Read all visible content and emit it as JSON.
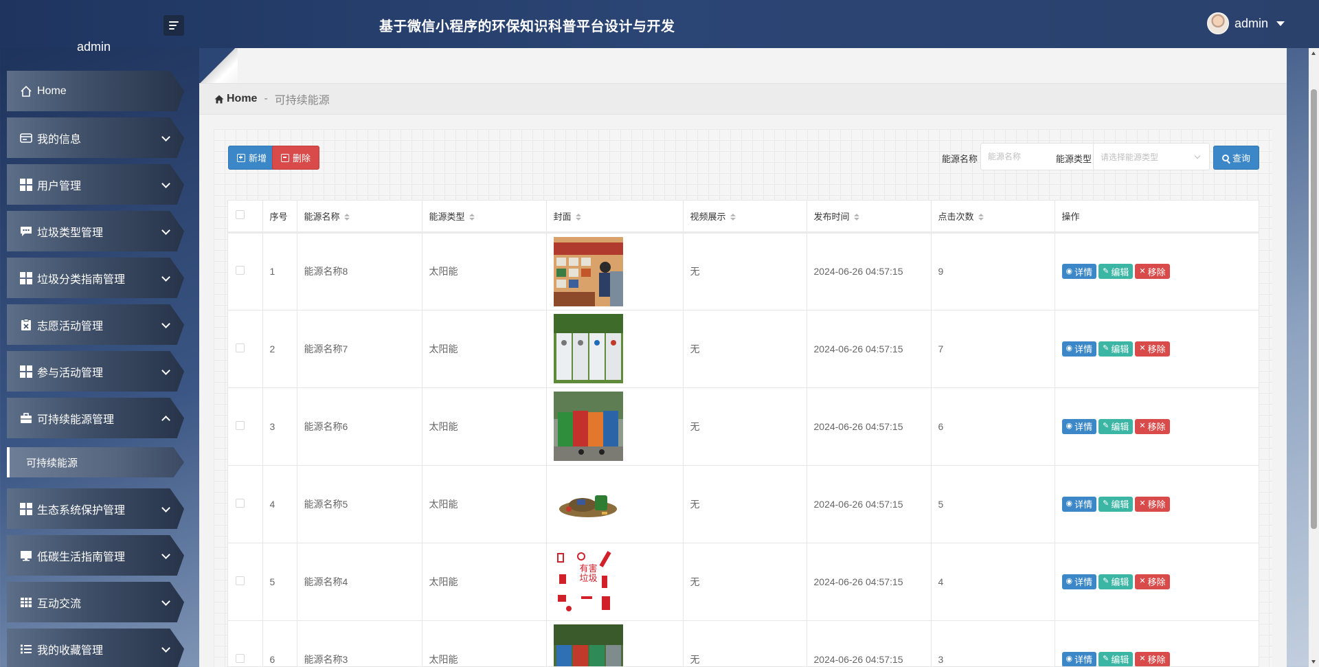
{
  "header": {
    "title": "基于微信小程序的环保知识科普平台设计与开发",
    "username": "admin",
    "sidebar_username": "admin"
  },
  "sidebar": {
    "items": [
      {
        "label": "Home",
        "icon": "home-icon",
        "expanded": false,
        "has_chevron": false
      },
      {
        "label": "我的信息",
        "icon": "id-card-icon",
        "expanded": false,
        "has_chevron": true
      },
      {
        "label": "用户管理",
        "icon": "grid-icon",
        "expanded": false,
        "has_chevron": true
      },
      {
        "label": "垃圾类型管理",
        "icon": "comment-icon",
        "expanded": false,
        "has_chevron": true
      },
      {
        "label": "垃圾分类指南管理",
        "icon": "grid-icon",
        "expanded": false,
        "has_chevron": true
      },
      {
        "label": "志愿活动管理",
        "icon": "clipboard-icon",
        "expanded": false,
        "has_chevron": true
      },
      {
        "label": "参与活动管理",
        "icon": "grid-icon",
        "expanded": false,
        "has_chevron": true
      },
      {
        "label": "可持续能源管理",
        "icon": "briefcase-icon",
        "expanded": true,
        "has_chevron": true
      },
      {
        "label": "生态系统保护管理",
        "icon": "grid-icon",
        "expanded": false,
        "has_chevron": true
      },
      {
        "label": "低碳生活指南管理",
        "icon": "monitor-icon",
        "expanded": false,
        "has_chevron": true
      },
      {
        "label": "互动交流",
        "icon": "table-icon",
        "expanded": false,
        "has_chevron": true
      },
      {
        "label": "我的收藏管理",
        "icon": "list-icon",
        "expanded": false,
        "has_chevron": true
      }
    ],
    "submenu_active": "可持续能源"
  },
  "breadcrumb": {
    "home": "Home",
    "separator": "-",
    "current": "可持续能源"
  },
  "toolbar": {
    "add_label": "新增",
    "delete_label": "删除",
    "name_filter_label": "能源名称",
    "name_filter_placeholder": "能源名称",
    "name_filter_value": "",
    "type_filter_label": "能源类型",
    "type_filter_placeholder": "请选择能源类型",
    "query_label": "查询"
  },
  "table": {
    "columns": [
      "序号",
      "能源名称",
      "能源类型",
      "封面",
      "视频展示",
      "发布时间",
      "点击次数",
      "操作"
    ],
    "sortable": [
      false,
      true,
      true,
      true,
      true,
      true,
      true,
      false
    ],
    "action_labels": {
      "detail": "详情",
      "edit": "编辑",
      "remove": "移除"
    },
    "rows": [
      {
        "index": "1",
        "name": "能源名称8",
        "type": "太阳能",
        "cover": "cover-photo-recycling-board",
        "video": "无",
        "time": "2024-06-26 04:57:15",
        "clicks": "9"
      },
      {
        "index": "2",
        "name": "能源名称7",
        "type": "太阳能",
        "cover": "cover-photo-white-bins",
        "video": "无",
        "time": "2024-06-26 04:57:15",
        "clicks": "7"
      },
      {
        "index": "3",
        "name": "能源名称6",
        "type": "太阳能",
        "cover": "cover-photo-color-bins",
        "video": "无",
        "time": "2024-06-26 04:57:15",
        "clicks": "6"
      },
      {
        "index": "4",
        "name": "能源名称5",
        "type": "太阳能",
        "cover": "cover-photo-trash-pile",
        "video": "无",
        "time": "2024-06-26 04:57:15",
        "clicks": "5"
      },
      {
        "index": "5",
        "name": "能源名称4",
        "type": "太阳能",
        "cover": "cover-hazardous-waste-poster",
        "video": "无",
        "time": "2024-06-26 04:57:15",
        "clicks": "4"
      },
      {
        "index": "6",
        "name": "能源名称3",
        "type": "太阳能",
        "cover": "cover-photo-bins-outdoor",
        "video": "无",
        "time": "2024-06-26 04:57:15",
        "clicks": "3"
      }
    ]
  },
  "cover_poster_text": "有害垃圾",
  "colors": {
    "primary": "#3b87c8",
    "danger": "#d94b4b",
    "success": "#3bb6a4",
    "header_bg": "#2b4574"
  }
}
